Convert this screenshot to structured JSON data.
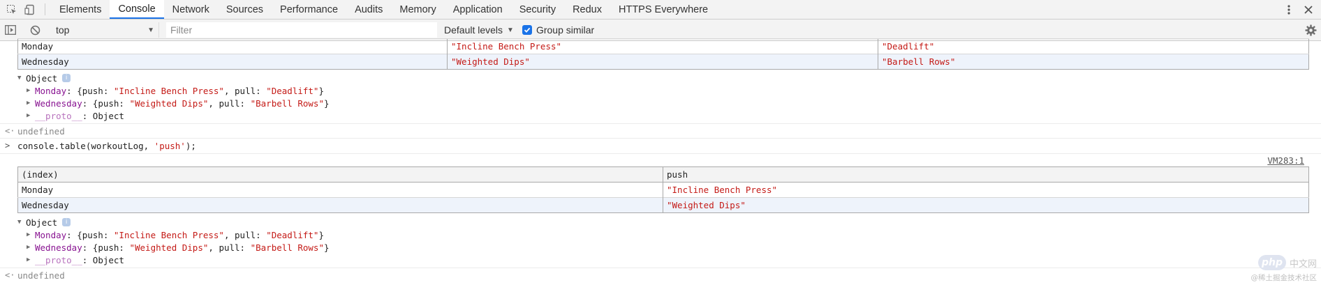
{
  "devtools": {
    "tabs": [
      "Elements",
      "Console",
      "Network",
      "Sources",
      "Performance",
      "Audits",
      "Memory",
      "Application",
      "Security",
      "Redux",
      "HTTPS Everywhere"
    ],
    "active_tab": "Console"
  },
  "toolbar": {
    "context": "top",
    "filter_placeholder": "Filter",
    "levels_label": "Default levels",
    "group_similar_label": "Group similar",
    "group_similar_checked": true
  },
  "first_table": {
    "rows": [
      {
        "index": "Monday",
        "push": "\"Incline Bench Press\"",
        "pull": "\"Deadlift\""
      },
      {
        "index": "Wednesday",
        "push": "\"Weighted Dips\"",
        "pull": "\"Barbell Rows\""
      }
    ]
  },
  "object_label": "Object",
  "info_badge": "i",
  "object_entries": {
    "monday_key": "Monday",
    "monday_push": "\"Incline Bench Press\"",
    "monday_pull": "\"Deadlift\"",
    "wednesday_key": "Wednesday",
    "wednesday_push": "\"Weighted Dips\"",
    "wednesday_pull": "\"Barbell Rows\"",
    "proto_key": "__proto__",
    "proto_value": "Object",
    "push_key": "push",
    "pull_key": "pull"
  },
  "result_text": "undefined",
  "command": {
    "prefix": "console.table(workoutLog, ",
    "arg": "'push'",
    "suffix": ");"
  },
  "source_link": "VM283:1",
  "second_table": {
    "headers": [
      "(index)",
      "push"
    ],
    "rows": [
      {
        "index": "Monday",
        "push": "\"Incline Bench Press\""
      },
      {
        "index": "Wednesday",
        "push": "\"Weighted Dips\""
      }
    ]
  },
  "watermark": {
    "badge": "php",
    "site": "中文网",
    "credit": "@稀土掘金技术社区"
  },
  "colors": {
    "accent": "#1a73e8",
    "string": "#c41a16",
    "property": "#881391"
  }
}
